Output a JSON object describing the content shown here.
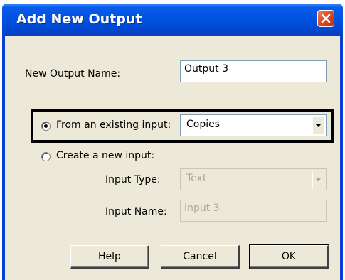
{
  "window": {
    "title": "Add New Output"
  },
  "form": {
    "output_name_label": "New Output Name:",
    "output_name_value": "Output 3",
    "existing_input_label": "From an existing input:",
    "existing_input_selected": "Copies",
    "new_input_label": "Create a new input:",
    "input_type_label": "Input Type:",
    "input_type_value": "Text",
    "input_name_label": "Input Name:",
    "input_name_value": "Input 3"
  },
  "buttons": {
    "help": "Help",
    "cancel": "Cancel",
    "ok": "OK"
  },
  "colors": {
    "titlebar": "#0054e3",
    "dialog_bg": "#ece9d8",
    "close_button": "#d84a22",
    "disabled_text": "#aca899"
  },
  "icons": {
    "close": "close-icon",
    "dropdown": "chevron-down-icon"
  }
}
